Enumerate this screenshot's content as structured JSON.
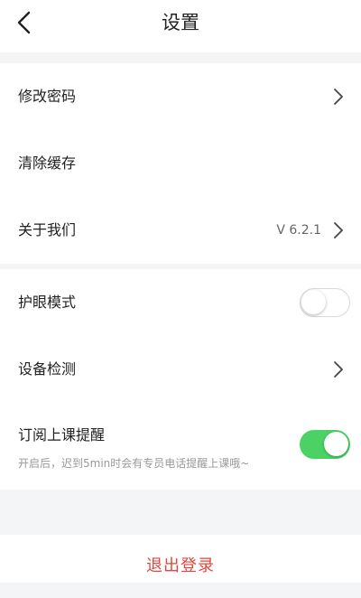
{
  "header": {
    "title": "设置"
  },
  "group1": {
    "change_password": "修改密码",
    "clear_cache": "清除缓存",
    "about_us": "关于我们",
    "version": "V 6.2.1"
  },
  "group2": {
    "eye_protection": "护眼模式",
    "eye_protection_on": false,
    "device_check": "设备检测",
    "class_reminder": "订阅上课提醒",
    "class_reminder_desc": "开启后，迟到5min时会有专员电话提醒上课哦~",
    "class_reminder_on": true
  },
  "footer": {
    "logout": "退出登录"
  },
  "colors": {
    "accent_red": "#e0473e",
    "toggle_on": "#4cd264",
    "background": "#f4f5f7"
  }
}
